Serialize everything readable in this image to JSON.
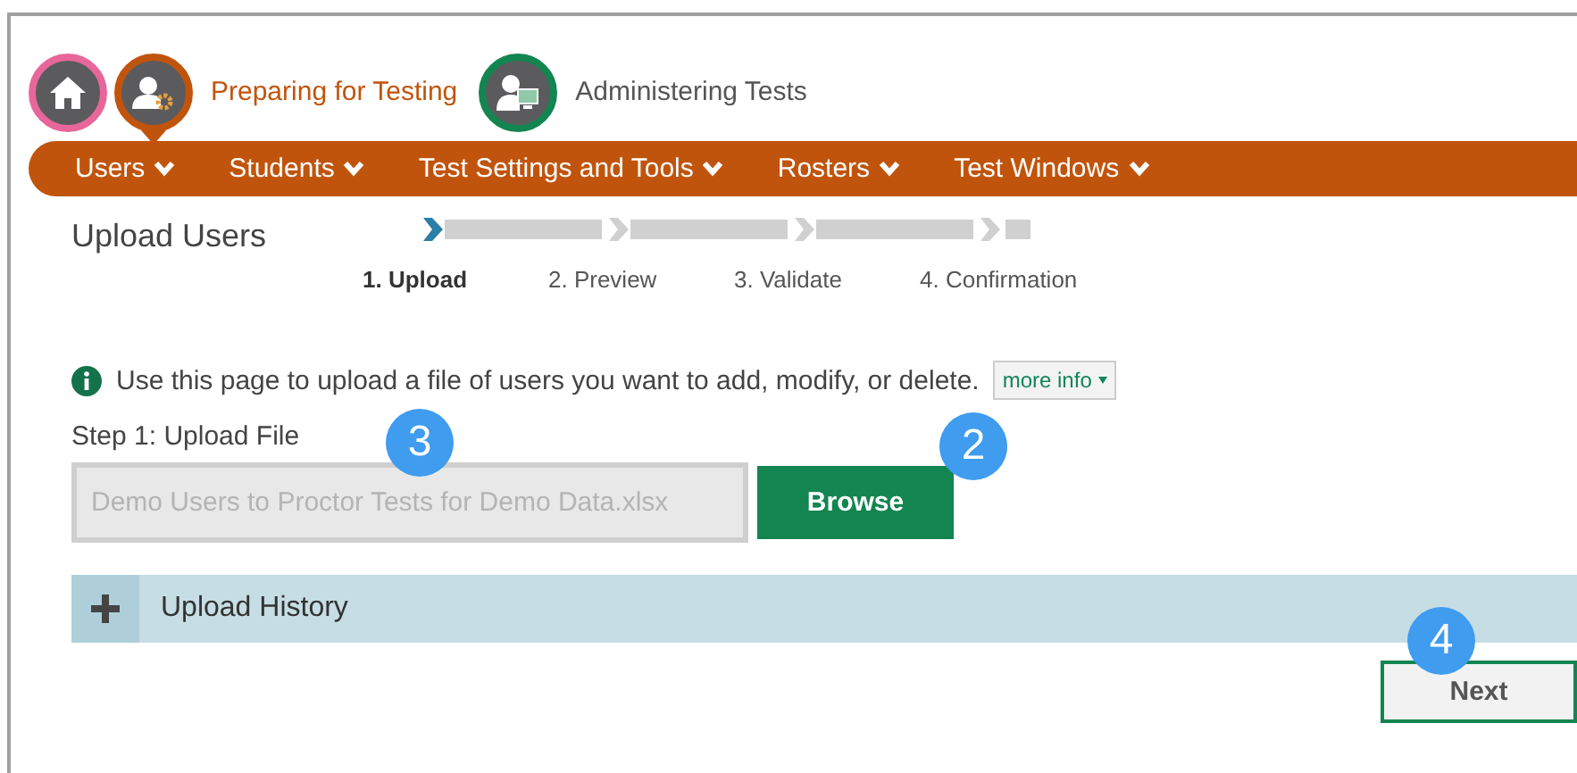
{
  "header": {
    "sections": [
      {
        "kind": "home",
        "color": "#e8679a",
        "selected": false
      },
      {
        "kind": "preparing",
        "label": "Preparing for Testing",
        "color": "#c1540c",
        "selected": true
      },
      {
        "kind": "administering",
        "label": "Administering Tests",
        "color": "#138550",
        "selected": false
      }
    ]
  },
  "nav": {
    "items": [
      {
        "label": "Users"
      },
      {
        "label": "Students"
      },
      {
        "label": "Test Settings and Tools"
      },
      {
        "label": "Rosters"
      },
      {
        "label": "Test Windows"
      }
    ]
  },
  "page_title": "Upload Users",
  "steps": [
    {
      "label": "1. Upload",
      "selected": true
    },
    {
      "label": "2. Preview",
      "selected": false
    },
    {
      "label": "3. Validate",
      "selected": false
    },
    {
      "label": "4. Confirmation",
      "selected": false
    }
  ],
  "info": {
    "text": "Use this page to upload a file of users you want to add, modify, or delete.",
    "more_info": "more info"
  },
  "upload": {
    "label": "Step 1: Upload File",
    "file_field": {
      "value": "Demo Users to Proctor Tests for Demo Data.xlsx",
      "annotation": "3"
    },
    "browse_button": {
      "label": "Browse",
      "annotation": "2"
    }
  },
  "upload_history": {
    "label": "Upload History",
    "expanded": false
  },
  "next_button": {
    "label": "Next",
    "annotation": "4"
  }
}
